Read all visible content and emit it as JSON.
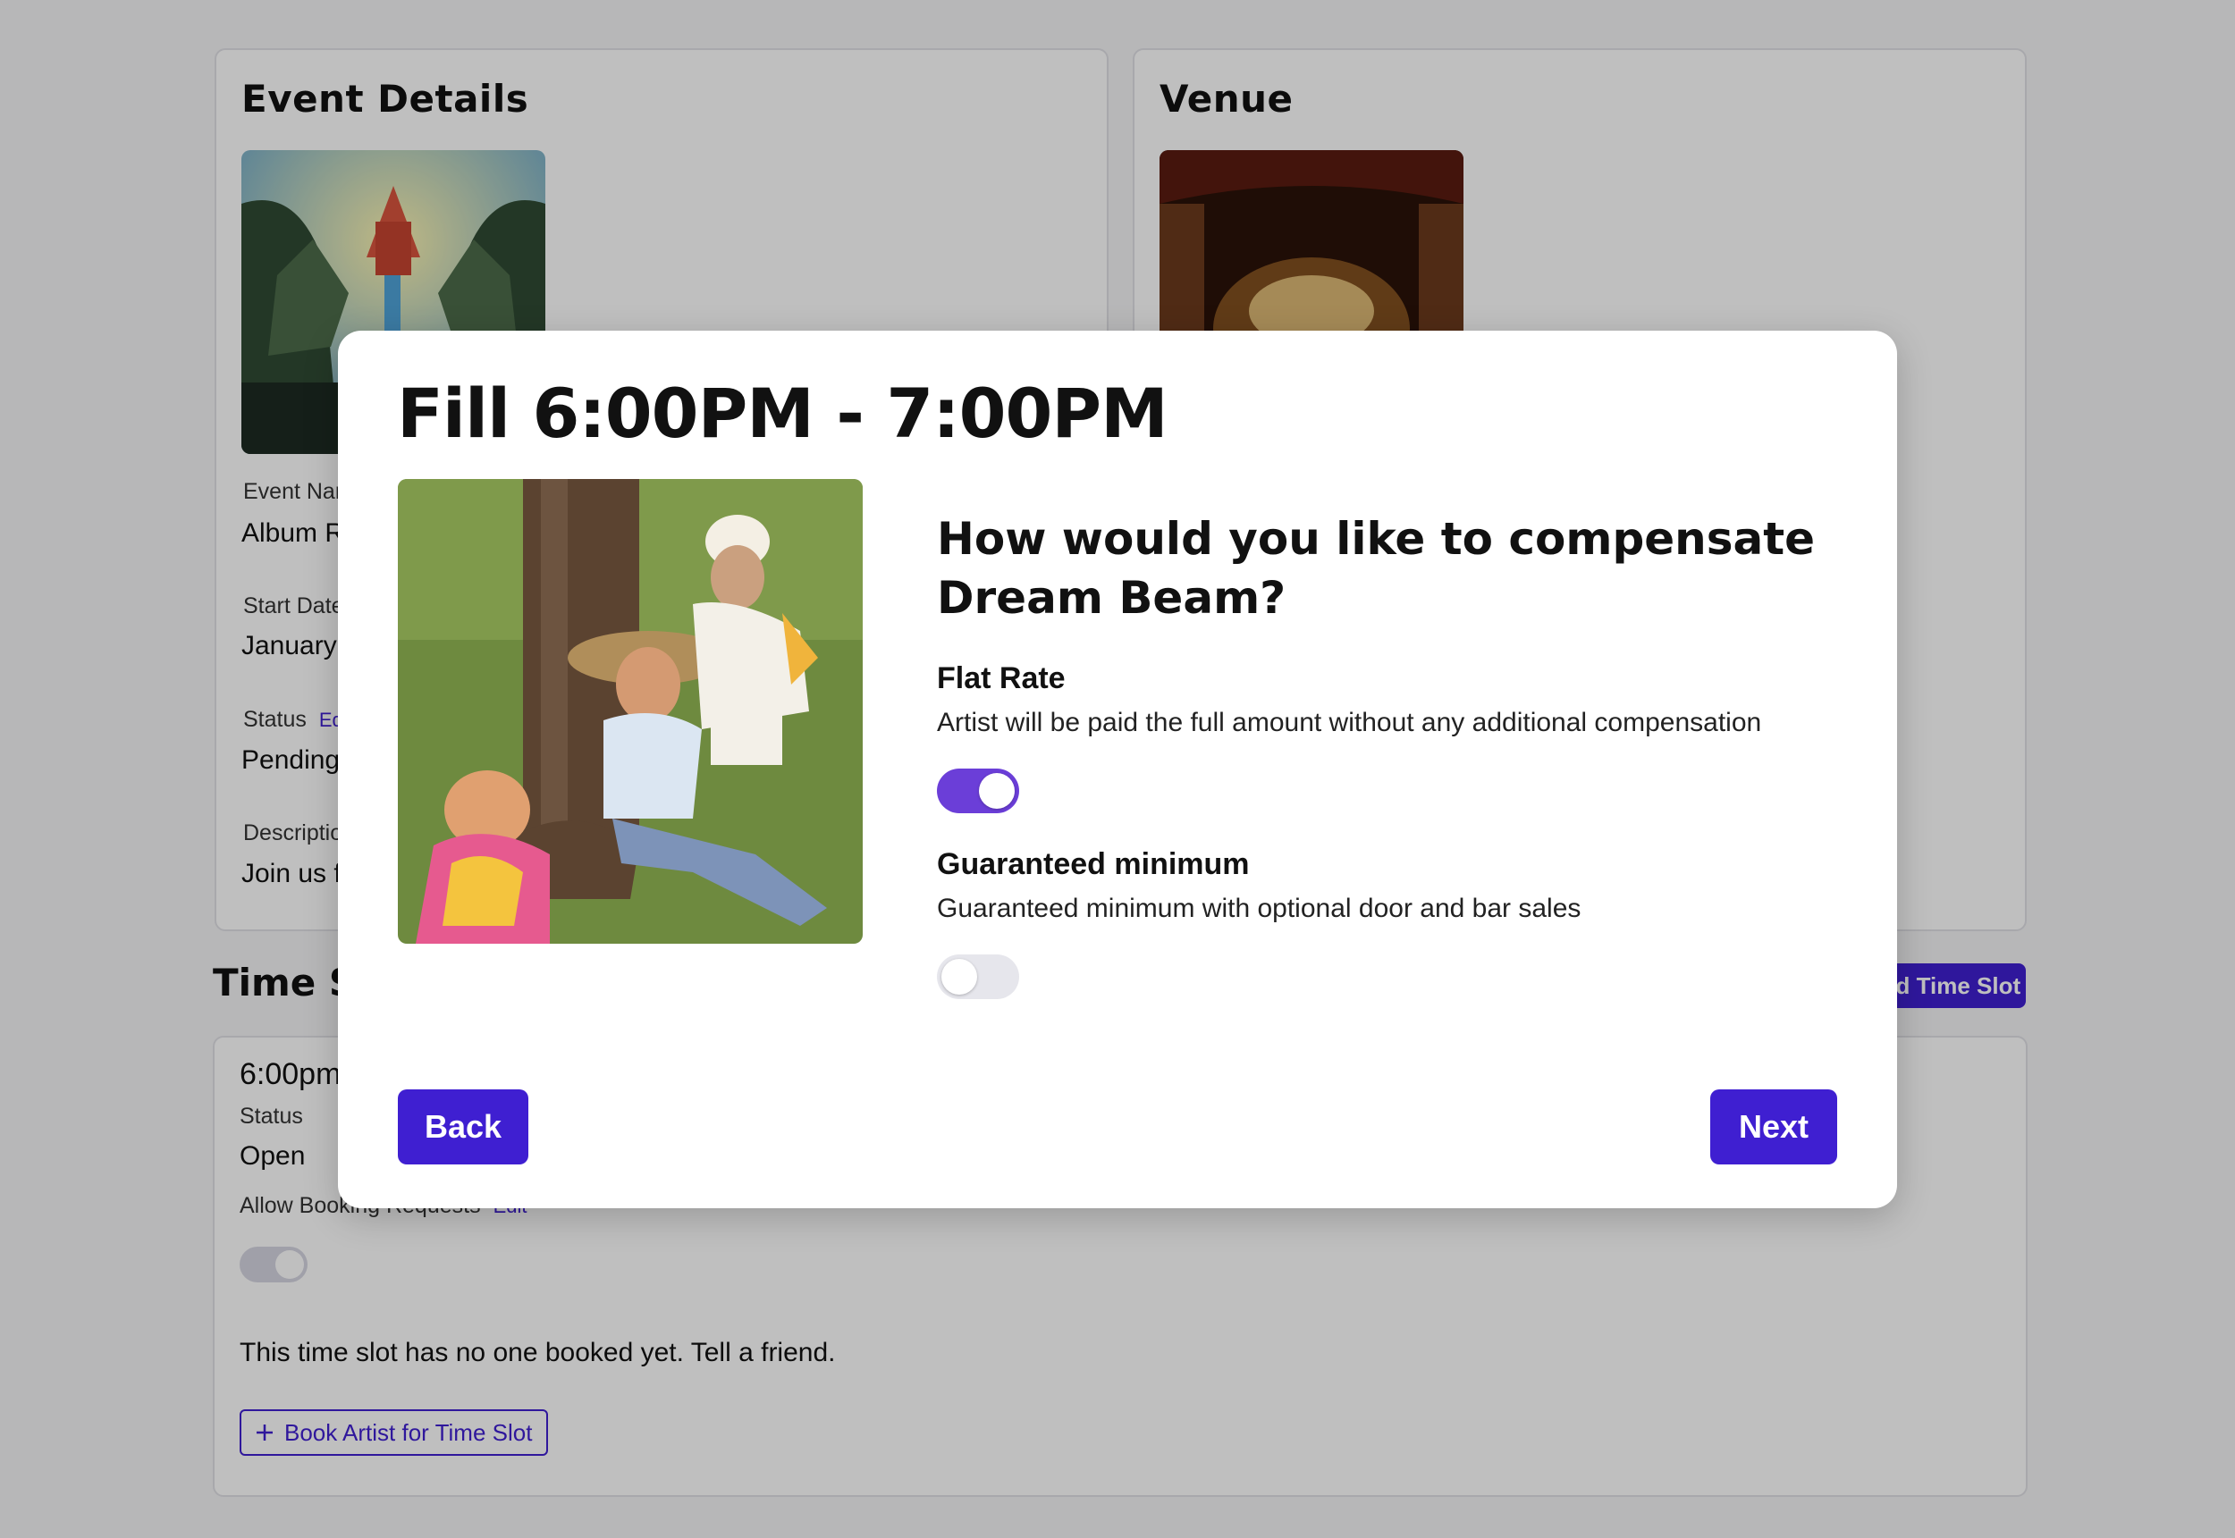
{
  "event_card": {
    "title": "Event Details",
    "fields": [
      {
        "label": "Event Name",
        "value": "Album Release"
      },
      {
        "label": "Start Date",
        "value": "January"
      },
      {
        "label": "Status",
        "value": "Pending",
        "edit": "Edit"
      },
      {
        "label": "Description",
        "value": "Join us for"
      }
    ]
  },
  "venue_card": {
    "title": "Venue"
  },
  "timeslots": {
    "heading": "Time Slots",
    "add_button": "Add Time Slot",
    "slot": {
      "time": "6:00pm",
      "status_label": "Status",
      "status_value": "Open",
      "allow_label": "Allow Booking Requests",
      "allow_edit": "Edit",
      "empty_message": "This time slot has no one booked yet. Tell a friend.",
      "book_button": "Book Artist for Time Slot",
      "book_icon": "plus-icon"
    }
  },
  "modal": {
    "title": "Fill 6:00PM - 7:00PM",
    "question": "How would you like to compensate Dream Beam?",
    "options": [
      {
        "title": "Flat Rate",
        "description": "Artist will be paid the full amount without any additional compensation",
        "enabled": true
      },
      {
        "title": "Guaranteed minimum",
        "description": "Guaranteed minimum with optional door and bar sales",
        "enabled": false
      }
    ],
    "back_label": "Back",
    "next_label": "Next"
  },
  "colors": {
    "accent": "#3f1fd1",
    "toggle_on": "#6b3ed8",
    "overlay": "rgba(0,0,0,0.25)"
  }
}
